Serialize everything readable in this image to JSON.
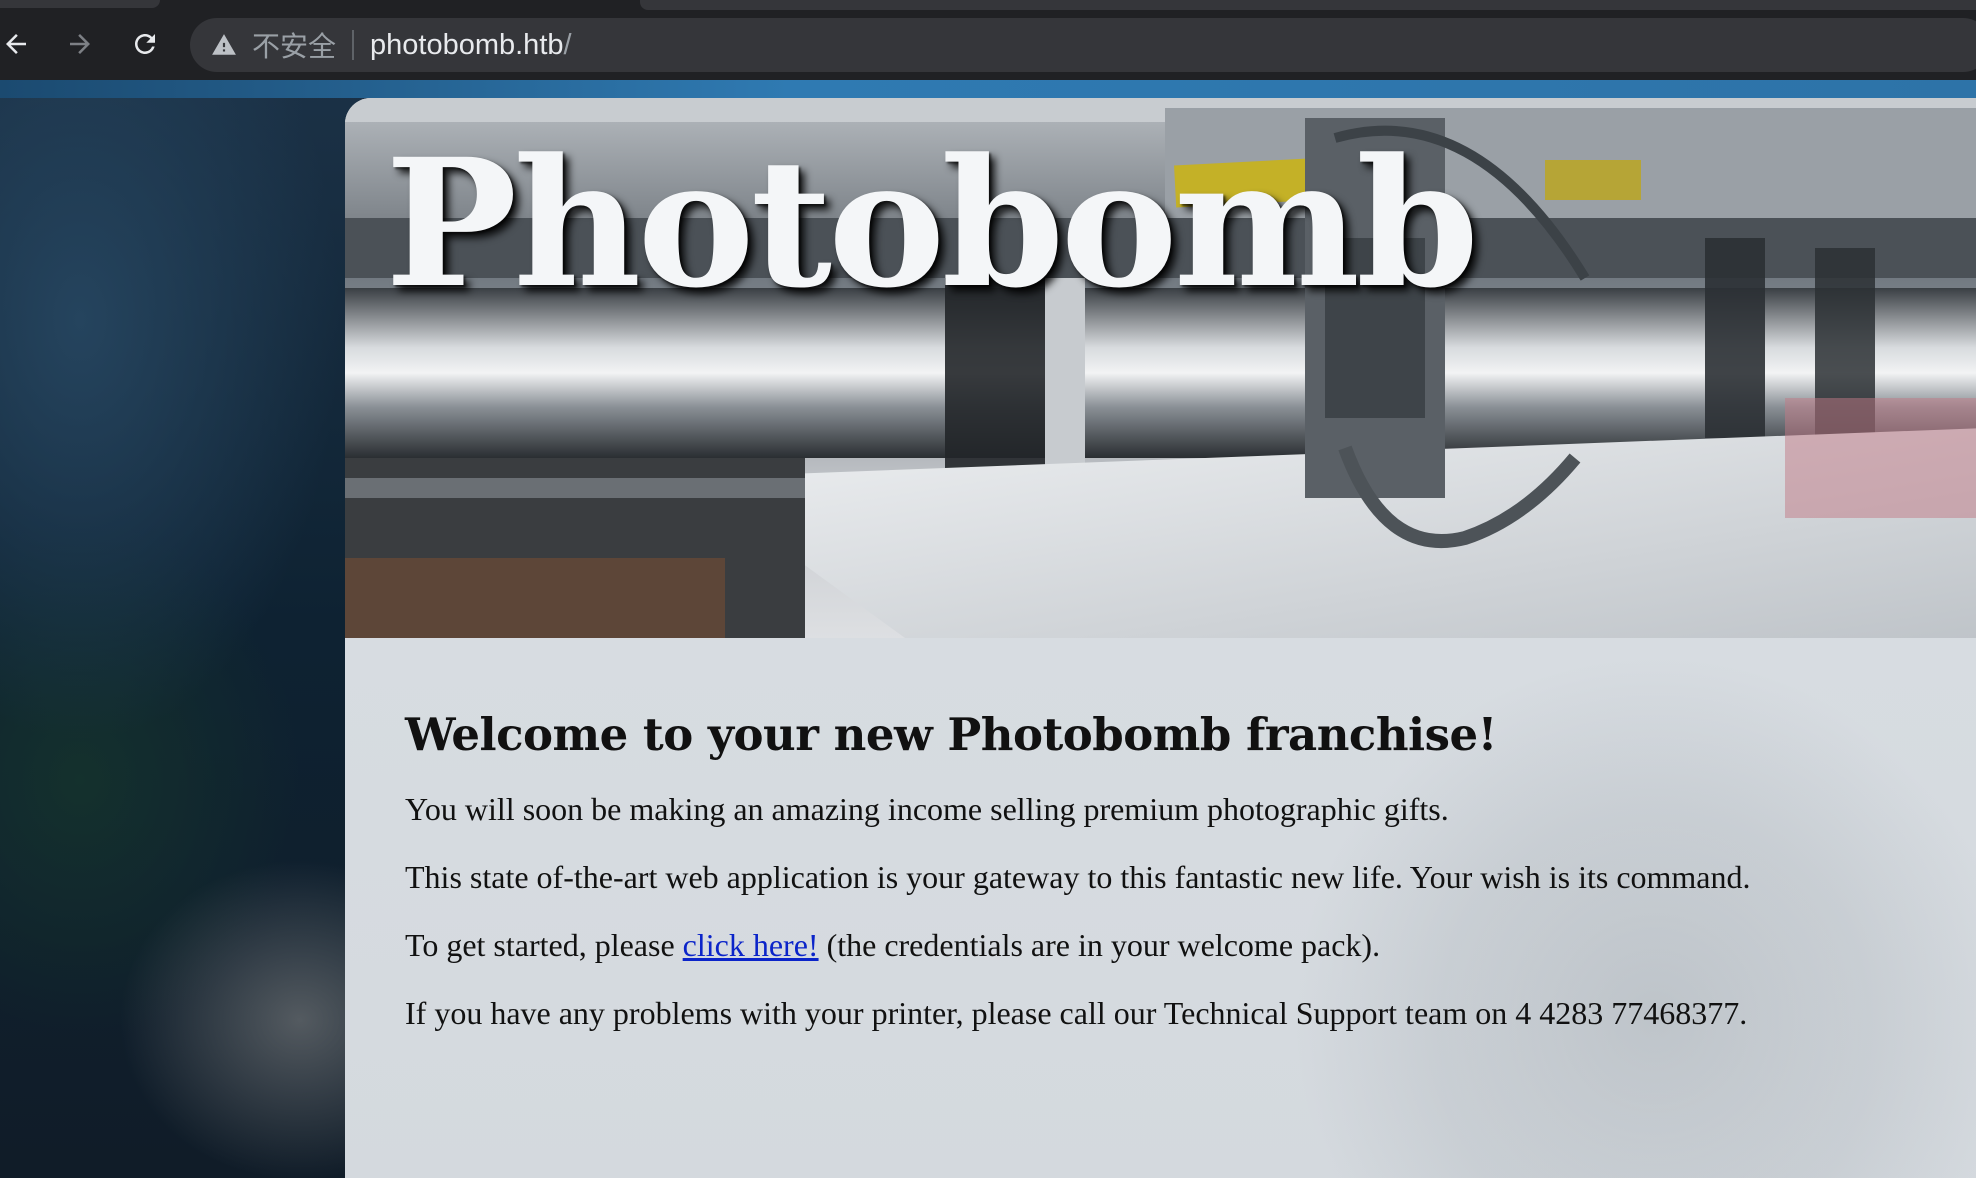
{
  "browser": {
    "security_label": "不安全",
    "url_host": "photobomb.htb",
    "url_path": "/"
  },
  "page": {
    "site_title": "Photobomb",
    "heading": "Welcome to your new Photobomb franchise!",
    "paragraph_1": "You will soon be making an amazing income selling premium photographic gifts.",
    "paragraph_2": "This state of-the-art web application is your gateway to this fantastic new life. Your wish is its command.",
    "paragraph_3_before": "To get started, please ",
    "paragraph_3_link": "click here!",
    "paragraph_3_after": " (the credentials are in your welcome pack).",
    "paragraph_4": "If you have any problems with your printer, please call our Technical Support team on 4 4283 77468377."
  },
  "colors": {
    "link": "#0b24c9",
    "chrome_bar": "#202124",
    "omnibox": "#35363a"
  },
  "icons": [
    "back-arrow-icon",
    "forward-arrow-icon",
    "reload-icon",
    "warning-triangle-icon"
  ]
}
